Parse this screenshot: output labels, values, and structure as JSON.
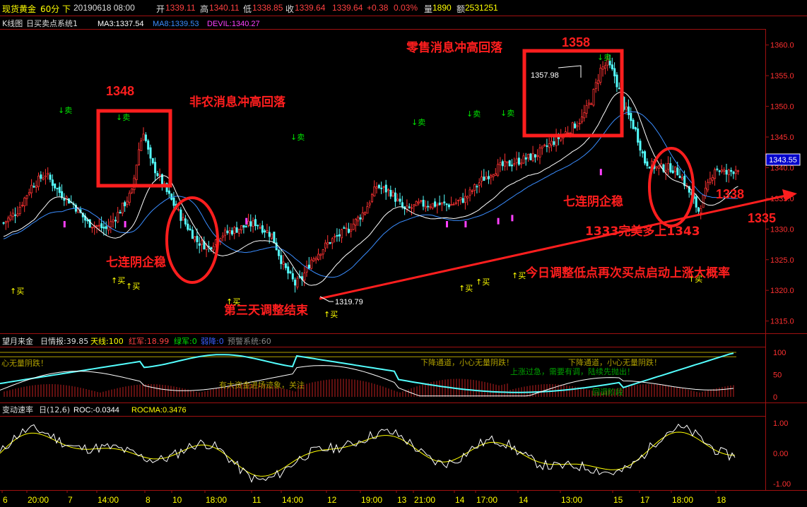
{
  "header": {
    "instrument": "现货黄金",
    "period": "60分",
    "direction": "下",
    "date": "20190618 08:00",
    "open_label": "开",
    "open": "1339.11",
    "high_label": "高",
    "high": "1340.11",
    "low_label": "低",
    "low": "1338.85",
    "close_label": "收",
    "close": "1339.64",
    "last": "1339.64",
    "change": "+0.38",
    "change_pct": "0.03%",
    "volume_label": "量",
    "volume": "1890",
    "amount_label": "额",
    "amount": "2531251"
  },
  "main_legend": {
    "title": "K线图",
    "system": "日买卖点系统1",
    "ma3": "MA3:1337.54",
    "ma8": "MA8:1339.53",
    "devil": "DEVIL:1340.27"
  },
  "price_axis": {
    "ticks": [
      "1360.0",
      "1355.0",
      "1350.0",
      "1345.0",
      "1340.0",
      "1335.0",
      "1330.0",
      "1325.0",
      "1320.0",
      "1315.0"
    ],
    "current": "1343.55"
  },
  "annotations": {
    "nfp_high": "1348",
    "nfp_text": "非农消息冲高回落",
    "retail_high": "1358",
    "retail_text": "零售消息冲高回落",
    "seven_left": "七连阴企稳",
    "seven_right": "七连阴企稳",
    "third_day": "第三天调整结束",
    "low_value": "1319.79",
    "high_value": "1357.98",
    "perfect": "1333完美多上1343",
    "today": "今日调整低点再次买点启动上涨大概率",
    "r1338": "1338",
    "r1335": "1335"
  },
  "signals": {
    "sell": "↓卖",
    "buy": "↑买"
  },
  "panel2": {
    "title": "望月来金",
    "info": "日情报:39.85",
    "tianxian": "天线:100",
    "hongjun": "红军:18.99",
    "lvjun": "绿军:0",
    "ruijiang": "弱降:0",
    "warn": "预警系统:60",
    "ticks": [
      "100",
      "50",
      "0"
    ],
    "msg_left": "心无量阴跌！",
    "msg_down1": "下降通道，小心无量阴跌！",
    "msg_down2": "下降通道，小心无量阴跌！",
    "msg_big": "有大资金进场迹象，关注",
    "msg_up": "上涨过急，需要有调，陆续先抛出！",
    "msg_green": "回调阶段"
  },
  "panel3": {
    "title": "变动速率",
    "params": "日(12,6)",
    "roc": "ROC:-0.0344",
    "rocma": "ROCMA:0.3476",
    "ticks": [
      "1.00",
      "0.00",
      "-1.00"
    ]
  },
  "time_axis": [
    "6",
    "20:00",
    "7",
    "14:00",
    "8",
    "10",
    "18:00",
    "11",
    "14:00",
    "12",
    "19:00",
    "13",
    "21:00",
    "14",
    "17:00",
    "14",
    "13:00",
    "15",
    "17",
    "18:00",
    "18"
  ],
  "colors": {
    "up": "#ff3232",
    "down": "#54ffff",
    "annot": "#ff1e1e",
    "sell": "#00e000",
    "buy": "#ffff00",
    "ma3": "#ffffff",
    "ma8": "#3a8dff",
    "devil": "#ff40ff"
  }
}
